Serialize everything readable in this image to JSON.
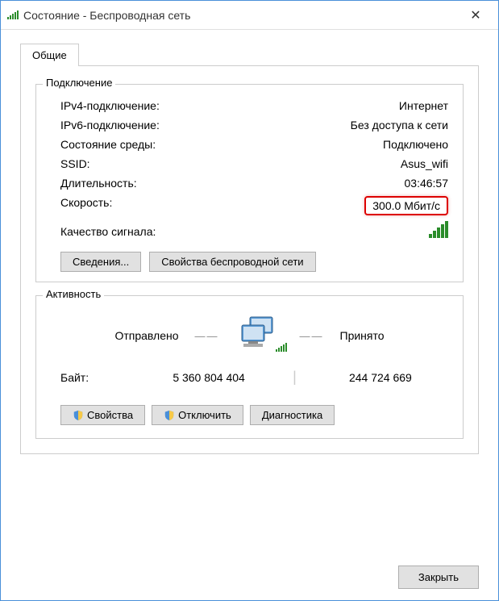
{
  "window": {
    "title": "Состояние - Беспроводная сеть"
  },
  "tabs": {
    "general": "Общие"
  },
  "connection": {
    "group_title": "Подключение",
    "ipv4_label": "IPv4-подключение:",
    "ipv4_value": "Интернет",
    "ipv6_label": "IPv6-подключение:",
    "ipv6_value": "Без доступа к сети",
    "media_label": "Состояние среды:",
    "media_value": "Подключено",
    "ssid_label": "SSID:",
    "ssid_value": "Asus_wifi",
    "duration_label": "Длительность:",
    "duration_value": "03:46:57",
    "speed_label": "Скорость:",
    "speed_value": "300.0 Мбит/с",
    "signal_label": "Качество сигнала:",
    "details_btn": "Сведения...",
    "wireless_props_btn": "Свойства беспроводной сети"
  },
  "activity": {
    "group_title": "Активность",
    "sent_label": "Отправлено",
    "received_label": "Принято",
    "bytes_label": "Байт:",
    "bytes_sent": "5 360 804 404",
    "bytes_received": "244 724 669",
    "properties_btn": "Свойства",
    "disable_btn": "Отключить",
    "diagnose_btn": "Диагностика"
  },
  "footer": {
    "close_btn": "Закрыть"
  }
}
